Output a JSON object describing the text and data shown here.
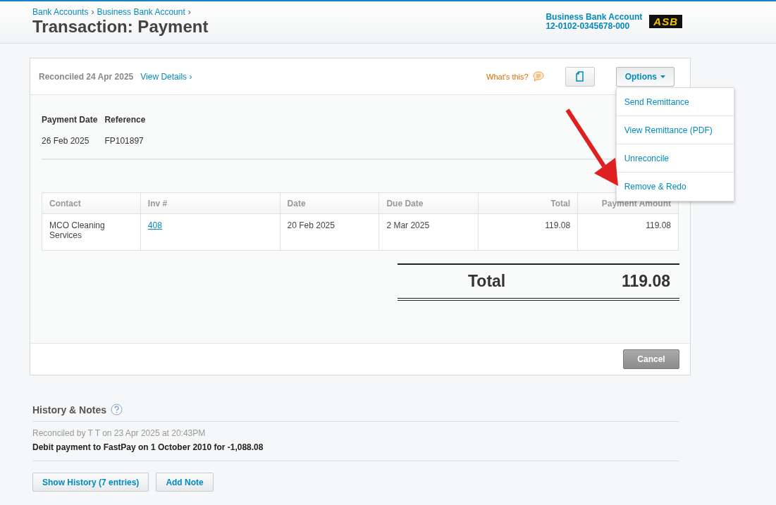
{
  "breadcrumbs": [
    {
      "label": "Bank Accounts",
      "separator": "›"
    },
    {
      "label": "Business Bank Account",
      "separator": "›"
    }
  ],
  "title": "Transaction: Payment",
  "account": {
    "name": "Business Bank Account",
    "number": "12-0102-0345678-000",
    "logo": "ASB"
  },
  "card": {
    "status": "Reconciled 24 Apr 2025",
    "details_link": "View Details ›",
    "help_link": "What's this?",
    "options": {
      "label": "Options",
      "expanded": true,
      "items": [
        "Send Remittance",
        "View Remittance (PDF)",
        "Unreconcile",
        "Remove & Redo"
      ]
    },
    "fields": [
      {
        "label": "Payment Date",
        "value": "26 Feb 2025"
      },
      {
        "label": "Reference",
        "value": "FP101897"
      }
    ],
    "table": {
      "columns": [
        "Contact",
        "Inv #",
        "Date",
        "Due Date",
        "Total",
        "Payment Amount"
      ],
      "rows": [
        {
          "cells": [
            {
              "text": "MCO Cleaning Services",
              "kind": "text"
            },
            {
              "text": "408",
              "kind": "link"
            },
            {
              "text": "20 Feb 2025",
              "kind": "text"
            },
            {
              "text": "2 Mar 2025",
              "kind": "text"
            },
            {
              "text": "119.08",
              "kind": "text"
            },
            {
              "text": "119.08",
              "kind": "text"
            }
          ]
        }
      ]
    },
    "total": {
      "label": "Total",
      "value": "119.08"
    },
    "cancel_button": "Cancel"
  },
  "history": {
    "title": "History & Notes",
    "entry_meta": "Reconciled by T T on 23 Apr 2025 at 20:43PM",
    "entry_text": "Debit payment to FastPay on 1 October 2010 for -1,088.08",
    "buttons": [
      "Show History (7 entries)",
      "Add Note"
    ]
  }
}
